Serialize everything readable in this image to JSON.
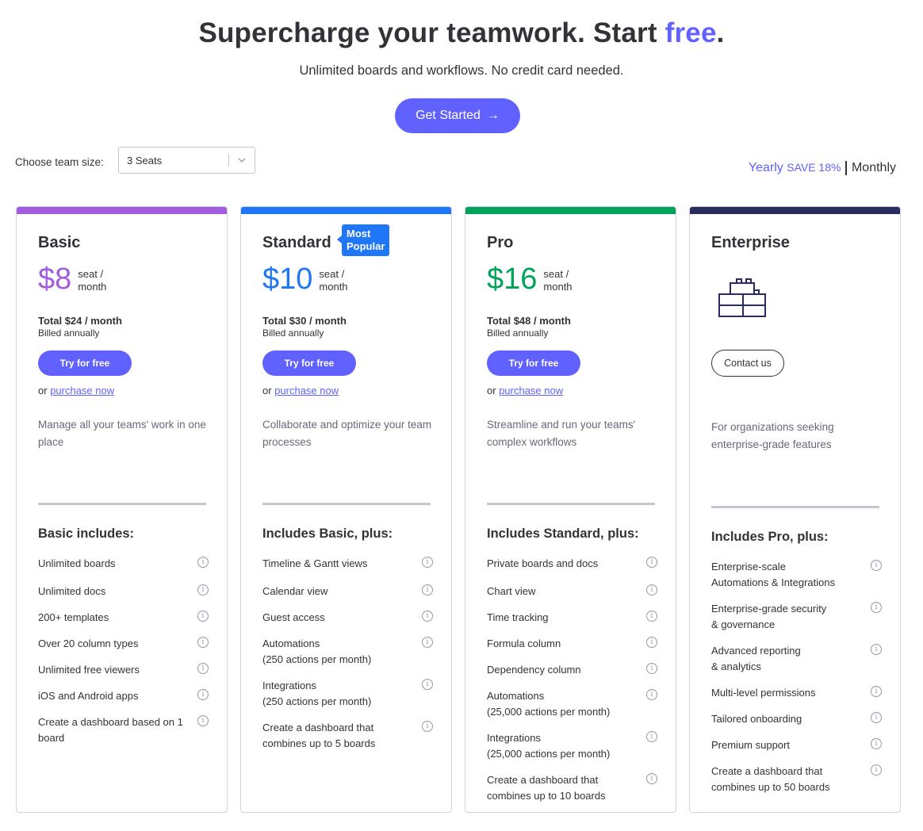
{
  "hero": {
    "title_main": "Supercharge your teamwork. Start ",
    "title_accent": "free",
    "title_end": ".",
    "subtitle": "Unlimited boards and workflows. No credit card needed.",
    "cta_label": "Get Started",
    "cta_arrow": "→"
  },
  "team_size": {
    "label": "Choose team size:",
    "selected": "3 Seats"
  },
  "billing": {
    "yearly": "Yearly",
    "save": "SAVE 18%",
    "monthly": "Monthly"
  },
  "colors": {
    "accent": "#6161ff",
    "basic": "#a25ddc",
    "standard": "#1f76f6",
    "pro": "#00a359",
    "enterprise": "#2b2c5e"
  },
  "plans": [
    {
      "name": "Basic",
      "price": "$8",
      "price_unit_1": "seat /",
      "price_unit_2": "month",
      "total": "Total $24 / month",
      "billed": "Billed annually",
      "try_label": "Try for free",
      "purchase_prefix": "or",
      "purchase_link": "purchase now",
      "description": "Manage all your teams' work in one place",
      "includes_title": "Basic includes:",
      "features": [
        [
          "Unlimited boards"
        ],
        [
          "Unlimited docs"
        ],
        [
          "200+ templates"
        ],
        [
          "Over 20 column types"
        ],
        [
          "Unlimited free viewers"
        ],
        [
          "iOS and Android apps"
        ],
        [
          "Create a dashboard based on 1",
          "board"
        ]
      ]
    },
    {
      "name": "Standard",
      "badge_1": "Most",
      "badge_2": "Popular",
      "price": "$10",
      "price_unit_1": "seat /",
      "price_unit_2": "month",
      "total": "Total $30 / month",
      "billed": "Billed annually",
      "try_label": "Try for free",
      "purchase_prefix": "or",
      "purchase_link": "purchase now",
      "description": "Collaborate and optimize your team processes",
      "includes_title": "Includes Basic, plus:",
      "features": [
        [
          "Timeline & Gantt views"
        ],
        [
          "Calendar view"
        ],
        [
          "Guest access"
        ],
        [
          "Automations",
          "(250 actions per month)"
        ],
        [
          "Integrations",
          "(250 actions per month)"
        ],
        [
          "Create a dashboard that",
          "combines up to 5 boards"
        ]
      ]
    },
    {
      "name": "Pro",
      "price": "$16",
      "price_unit_1": "seat /",
      "price_unit_2": "month",
      "total": "Total $48 / month",
      "billed": "Billed annually",
      "try_label": "Try for free",
      "purchase_prefix": "or",
      "purchase_link": "purchase now",
      "description": "Streamline and run your teams' complex workflows",
      "includes_title": "Includes Standard, plus:",
      "features": [
        [
          "Private boards and docs"
        ],
        [
          "Chart view"
        ],
        [
          "Time tracking"
        ],
        [
          "Formula column"
        ],
        [
          "Dependency column"
        ],
        [
          "Automations",
          "(25,000 actions per month)"
        ],
        [
          "Integrations",
          "(25,000 actions per month)"
        ],
        [
          "Create a dashboard that",
          "combines up to 10 boards"
        ]
      ]
    },
    {
      "name": "Enterprise",
      "icon": "building-blocks-icon",
      "contact_label": "Contact us",
      "description": "For organizations seeking enterprise-grade features",
      "includes_title": "Includes Pro, plus:",
      "features": [
        [
          "Enterprise-scale",
          "Automations & Integrations"
        ],
        [
          "Enterprise-grade security",
          "& governance"
        ],
        [
          "Advanced reporting",
          "& analytics"
        ],
        [
          "Multi-level permissions"
        ],
        [
          "Tailored onboarding"
        ],
        [
          "Premium support"
        ],
        [
          "Create a dashboard that",
          "combines up to 50 boards"
        ]
      ]
    }
  ]
}
